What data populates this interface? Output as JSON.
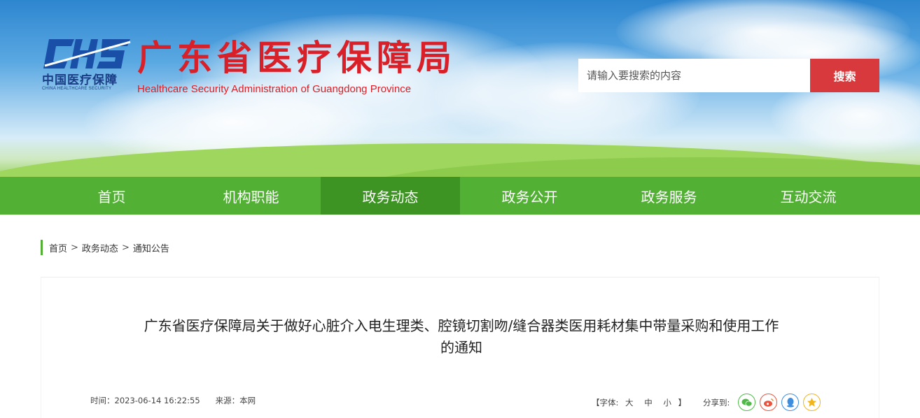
{
  "header": {
    "logo_abbr": "CHS",
    "logo_cn": "中国医疗保障",
    "logo_en": "CHINA HEALTHCARE SECURITY",
    "site_title": "广东省医疗保障局",
    "site_subtitle": "Healthcare Security Administration of Guangdong Province",
    "search_placeholder": "请输入要搜索的内容",
    "search_button": "搜索"
  },
  "nav": {
    "items": [
      {
        "label": "首页"
      },
      {
        "label": "机构职能"
      },
      {
        "label": "政务动态",
        "active": true
      },
      {
        "label": "政务公开"
      },
      {
        "label": "政务服务"
      },
      {
        "label": "互动交流"
      }
    ]
  },
  "breadcrumb": {
    "items": [
      "首页",
      "政务动态",
      "通知公告"
    ],
    "separator": ">"
  },
  "article": {
    "title_line1": "广东省医疗保障局关于做好心脏介入电生理类、腔镜切割吻/缝合器类医用耗材集中带量采购和使用工作",
    "title_line2": "的通知",
    "time": "时间：2023-06-14 16:22:55",
    "source": "来源：本网",
    "font_size_open": "【字体:",
    "font_large": "大",
    "font_medium": "中",
    "font_small": "小",
    "font_size_close": "】",
    "share_label": "分享到:",
    "share_icons": [
      "wechat-icon",
      "weibo-icon",
      "qq-icon",
      "qzone-icon"
    ]
  },
  "colors": {
    "brand_red": "#d92028",
    "nav_green": "#52b134",
    "nav_active": "#3d9423",
    "search_btn": "#d8393c"
  }
}
